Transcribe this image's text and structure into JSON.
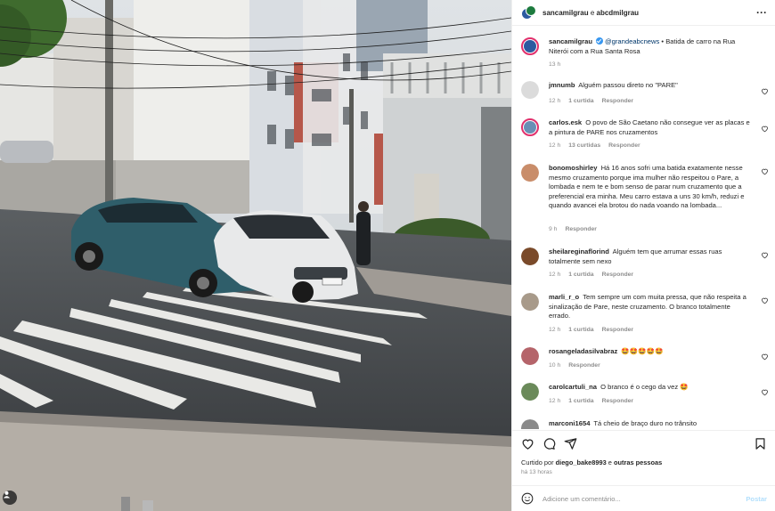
{
  "header": {
    "user1": "sancamilgrau",
    "separator": "e",
    "user2": "abcdmilgrau",
    "more_icon": "ellipsis-icon"
  },
  "caption": {
    "username": "sancamilgrau",
    "mention": "@grandeabcnews",
    "text": "• Batida de carro na Rua Niterói com a Rua Santa Rosa",
    "time": "13 h"
  },
  "comments": [
    {
      "username": "jmnumb",
      "text": "Alguém passou direto no \"PARE\"",
      "time": "12 h",
      "likes": "1 curtida",
      "reply": "Responder"
    },
    {
      "username": "carlos.esk",
      "text": "O povo de São Caetano não consegue ver as placas e a pintura de PARE nos cruzamentos",
      "time": "12 h",
      "likes": "13 curtidas",
      "reply": "Responder"
    },
    {
      "username": "bonomoshirley",
      "text": "Há 16 anos sofri uma batida exatamente nesse mesmo cruzamento porque ima mulher não respeitou o Pare, a lombada e nem te e bom senso de parar num cruzamento que a preferencial era minha. Meu carro estava a uns 30 km/h, reduzi e quando avancei ela brotou do nada voando na lombada...",
      "time": "9 h",
      "likes": "",
      "reply": "Responder"
    },
    {
      "username": "sheilareginaflorind",
      "text": "Alguém tem que arrumar essas ruas totalmente sem nexo",
      "time": "12 h",
      "likes": "1 curtida",
      "reply": "Responder"
    },
    {
      "username": "marli_r_o",
      "text": "Tem sempre um com muita pressa, que não respeita a sinalização de Pare, neste cruzamento. O branco totalmente errado.",
      "time": "12 h",
      "likes": "1 curtida",
      "reply": "Responder"
    },
    {
      "username": "rosangeladasilvabraz",
      "text": "🤩🤩🤩🤩🤩",
      "time": "10 h",
      "likes": "",
      "reply": "Responder"
    },
    {
      "username": "carolcartuli_na",
      "text": "O branco é o cego da vez 🤩",
      "time": "12 h",
      "likes": "1 curtida",
      "reply": "Responder"
    },
    {
      "username": "marconi1654",
      "text": "Tá cheio de braço duro no trânsito",
      "time": "",
      "likes": "",
      "reply": ""
    }
  ],
  "liked_by": {
    "prefix": "Curtido por",
    "user": "diego_bake8993",
    "joiner": "e",
    "others": "outras pessoas"
  },
  "post_time": "há 13 horas",
  "comment_box": {
    "placeholder": "Adicione um comentário...",
    "post_label": "Postar"
  },
  "colors": {
    "link": "#00376b",
    "meta": "#8e8e8e",
    "post_disabled": "#b2dffc",
    "verified": "#3897f0"
  }
}
